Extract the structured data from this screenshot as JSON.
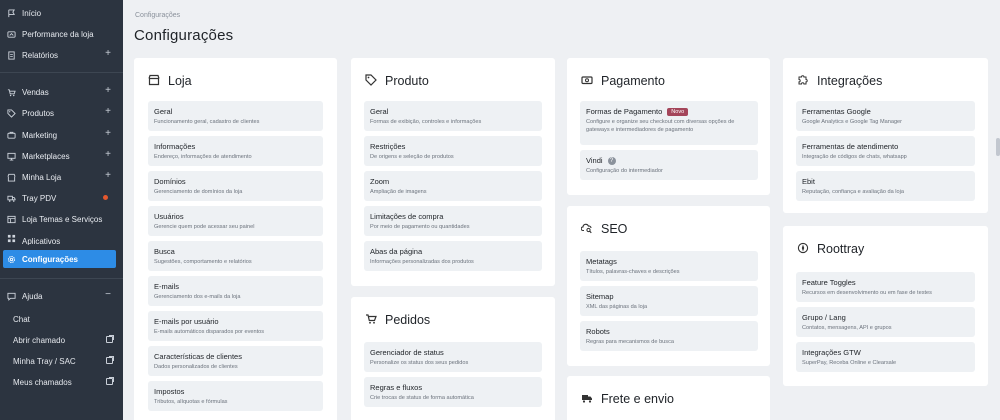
{
  "sidebar": {
    "items": [
      {
        "label": "Início",
        "icon": "flag-icon"
      },
      {
        "label": "Performance da loja",
        "icon": "gauge-icon"
      },
      {
        "label": "Relatórios",
        "icon": "report-icon"
      },
      {
        "label": "Vendas",
        "icon": "cart-icon"
      },
      {
        "label": "Produtos",
        "icon": "tag-icon"
      },
      {
        "label": "Marketing",
        "icon": "megaphone-icon"
      },
      {
        "label": "Marketplaces",
        "icon": "store-icon"
      },
      {
        "label": "Minha Loja",
        "icon": "shop-icon"
      },
      {
        "label": "Tray PDV",
        "icon": "truck-icon"
      },
      {
        "label": "Loja Temas e Serviços",
        "icon": "grid-icon"
      },
      {
        "label": "Aplicativos",
        "icon": "apps-icon"
      },
      {
        "label": "Configurações",
        "icon": "gear-icon"
      },
      {
        "label": "Ajuda",
        "icon": "chat-icon"
      }
    ],
    "help_sub": [
      {
        "label": "Chat"
      },
      {
        "label": "Abrir chamado"
      },
      {
        "label": "Minha Tray / SAC"
      },
      {
        "label": "Meus chamados"
      }
    ],
    "plus": "+",
    "minus": "−"
  },
  "header": {
    "breadcrumb": "Configurações",
    "title": "Configurações"
  },
  "cards": {
    "loja": {
      "title": "Loja",
      "options": [
        {
          "title": "Geral",
          "desc": "Funcionamento geral, cadastro de clientes"
        },
        {
          "title": "Informações",
          "desc": "Endereço, informações de atendimento"
        },
        {
          "title": "Domínios",
          "desc": "Gerenciamento de domínios da loja"
        },
        {
          "title": "Usuários",
          "desc": "Gerencie quem pode acessar seu painel"
        },
        {
          "title": "Busca",
          "desc": "Sugestões, comportamento e relatórios"
        },
        {
          "title": "E-mails",
          "desc": "Gerenciamento dos e-mails da loja"
        },
        {
          "title": "E-mails por usuário",
          "desc": "E-mails automáticos disparados por eventos"
        },
        {
          "title": "Características de clientes",
          "desc": "Dados personalizados de clientes"
        },
        {
          "title": "Impostos",
          "desc": "Tributos, alíquotas e fórmulas"
        }
      ]
    },
    "produto": {
      "title": "Produto",
      "options": [
        {
          "title": "Geral",
          "desc": "Formas de exibição, controles e informações"
        },
        {
          "title": "Restrições",
          "desc": "De origens e seleção de produtos"
        },
        {
          "title": "Zoom",
          "desc": "Ampliação de imagens"
        },
        {
          "title": "Limitações de compra",
          "desc": "Por meio de pagamento ou quantidades"
        },
        {
          "title": "Abas da página",
          "desc": "Informações personalizadas dos produtos"
        }
      ]
    },
    "pedidos": {
      "title": "Pedidos",
      "options": [
        {
          "title": "Gerenciador de status",
          "desc": "Personalize os status dos seus pedidos"
        },
        {
          "title": "Regras e fluxos",
          "desc": "Crie trocas de status de forma automática"
        }
      ]
    },
    "pagamento": {
      "title": "Pagamento",
      "options": [
        {
          "title": "Formas de Pagamento",
          "badge": "Novo",
          "desc": "Configure e organize seu checkout com diversas opções de gateways e intermediadores de pagamento"
        },
        {
          "title": "Vindi",
          "desc": "Configuração do intermediador"
        }
      ]
    },
    "seo": {
      "title": "SEO",
      "options": [
        {
          "title": "Metatags",
          "desc": "Títulos, palavras-chaves e descrições"
        },
        {
          "title": "Sitemap",
          "desc": "XML das páginas da loja"
        },
        {
          "title": "Robots",
          "desc": "Regras para mecanismos de busca"
        }
      ]
    },
    "frete": {
      "title": "Frete e envio"
    },
    "integracoes": {
      "title": "Integrações",
      "options": [
        {
          "title": "Ferramentas Google",
          "desc": "Google Analytics e Google Tag Manager"
        },
        {
          "title": "Ferramentas de atendimento",
          "desc": "Integração de códigos de chats, whatsapp"
        },
        {
          "title": "Ebit",
          "desc": "Reputação, confiança e avaliação da loja"
        }
      ]
    },
    "roottray": {
      "title": "Roottray",
      "options": [
        {
          "title": "Feature Toggles",
          "desc": "Recursos em desenvolvimento ou em fase de testes"
        },
        {
          "title": "Grupo / Lang",
          "desc": "Contatos, mensagens, API e grupos"
        },
        {
          "title": "Integrações GTW",
          "desc": "SuperPay, Receba Online e Clearsale"
        }
      ]
    }
  },
  "colors": {
    "sidebar_bg": "#2c3440",
    "active_bg": "#2d8ce6",
    "badge_bg": "#a4455a",
    "page_bg": "#eef0f3"
  }
}
